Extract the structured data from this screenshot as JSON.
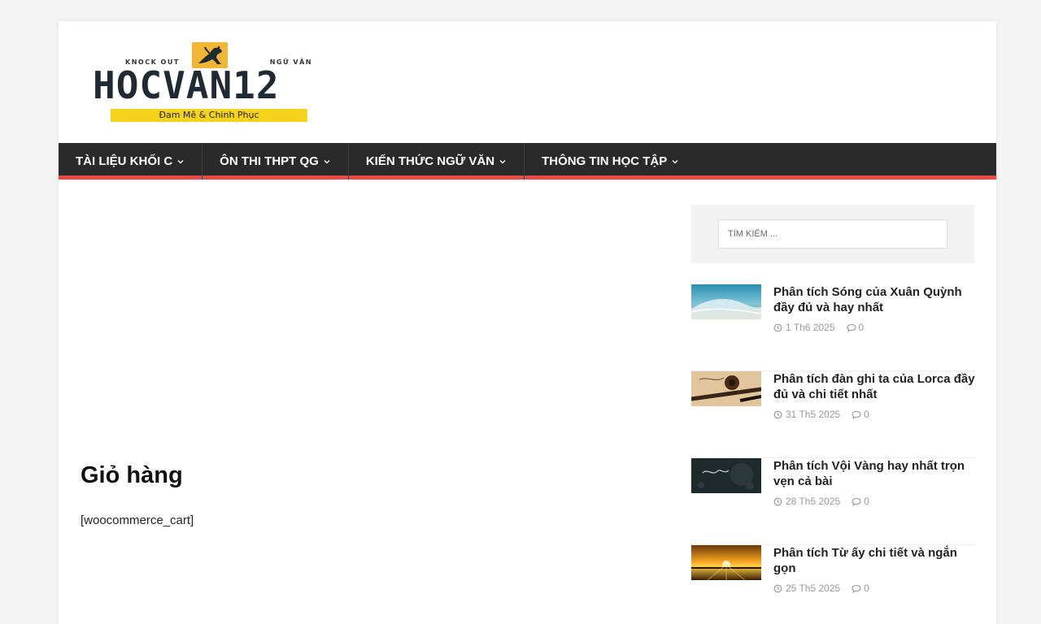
{
  "site": {
    "logo": {
      "top_left": "KNOCK OUT",
      "top_right": "NGỮ VĂN",
      "wordmark": "HOCVAN12",
      "tagline": "Đam Mê & Chinh Phục",
      "tagline_color": "#f5d21c",
      "mark_color": "#f2b635"
    }
  },
  "nav": {
    "items": [
      {
        "label": "TÀI LIỆU KHỐI C"
      },
      {
        "label": "ÔN THI THPT QG"
      },
      {
        "label": "KIẾN THỨC NGỮ VĂN"
      },
      {
        "label": "THÔNG TIN HỌC TẬP"
      }
    ],
    "background": "#2a2a2a",
    "accent": "#e64946"
  },
  "main": {
    "title": "Giỏ hàng",
    "body_text": "[woocommerce_cart]"
  },
  "sidebar": {
    "search": {
      "placeholder": "TÌM KIẾM ..."
    },
    "posts": [
      {
        "title": "Phân tích Sóng của Xuân Quỳnh đầy đủ và hay nhất",
        "date": "1 Th6 2025",
        "comments": "0",
        "thumb": "ocean-wave"
      },
      {
        "title": "Phân tích đàn ghi ta của Lorca đầy đủ và chi tiết nhất",
        "date": "31 Th5 2025",
        "comments": "0",
        "thumb": "guitar"
      },
      {
        "title": "Phân tích Vội Vàng hay nhất trọn vẹn cả bài",
        "date": "28 Th5 2025",
        "comments": "0",
        "thumb": "dark-calligraphy"
      },
      {
        "title": "Phân tích Từ ấy chi tiết và ngắn gọn",
        "date": "25 Th5 2025",
        "comments": "0",
        "thumb": "sunset"
      }
    ]
  }
}
